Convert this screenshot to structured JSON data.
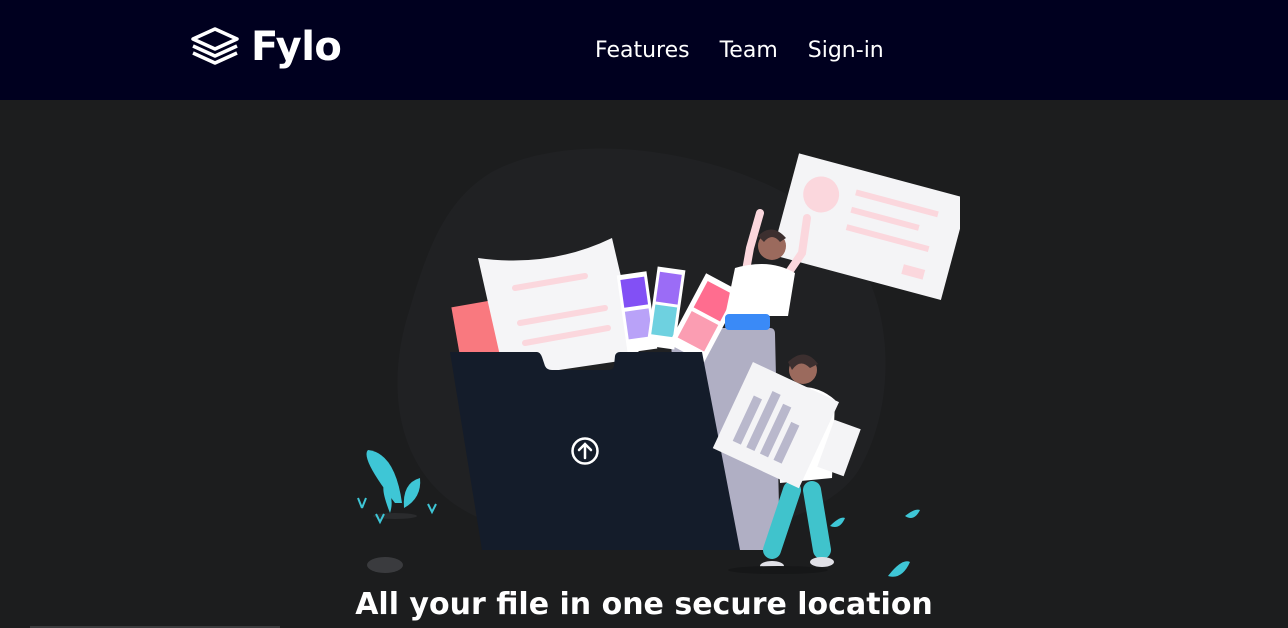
{
  "brand": {
    "name": "Fylo",
    "logo_icon": "layers-icon"
  },
  "nav": {
    "links": [
      {
        "label": "Features"
      },
      {
        "label": "Team"
      },
      {
        "label": "Sign-in"
      }
    ]
  },
  "hero": {
    "headline": "All your file in one secure location",
    "illustration_icon": "upload-icon"
  },
  "colors": {
    "nav_bg": "#00001f",
    "page_bg": "#1c1d1e",
    "text": "#ffffff",
    "folder": "#141c2a",
    "accent_teal": "#3ec6d6",
    "accent_pink": "#fbdadf"
  }
}
